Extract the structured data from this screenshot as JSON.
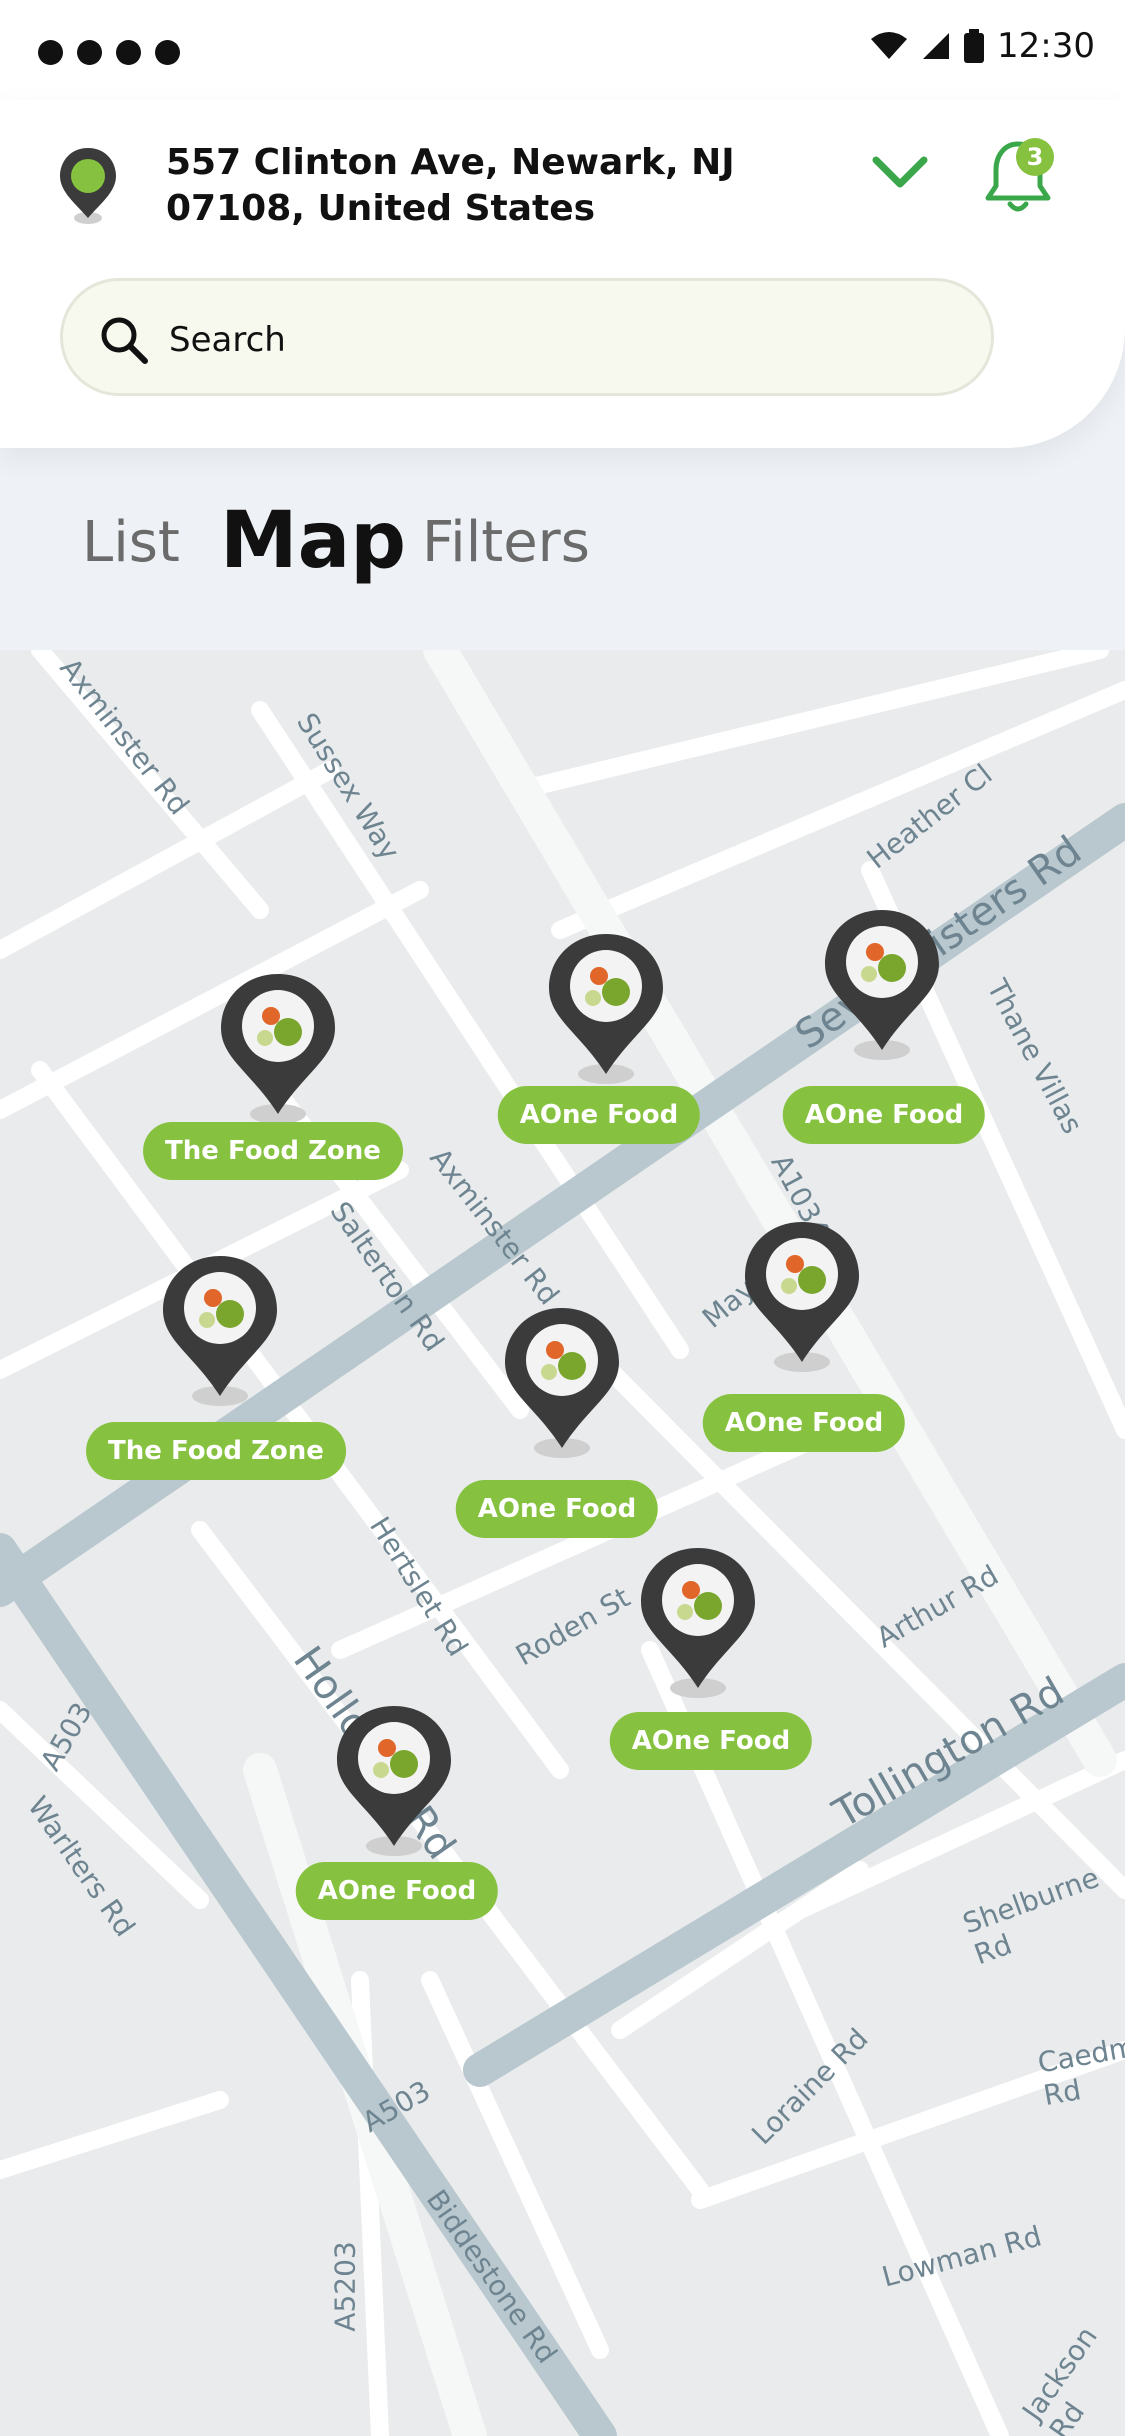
{
  "status_bar": {
    "time": "12:30"
  },
  "header": {
    "address": "557 Clinton Ave, Newark, NJ 07108, United States",
    "notification_count": "3"
  },
  "search": {
    "placeholder": "Search"
  },
  "tabs": {
    "list": "List",
    "map": "Map",
    "filters": "Filters"
  },
  "colors": {
    "accent": "#86c240",
    "pin": "#3b3b3b"
  },
  "map": {
    "streets": [
      "Axminster Rd",
      "Sussex Way",
      "Heather Cl",
      "Seven Sisters Rd",
      "Thane Villas",
      "A1034",
      "Salterton Rd",
      "Axminster Rd",
      "Mayton St",
      "Hertslet Rd",
      "Roden St",
      "Arthur Rd",
      "Tollington Rd",
      "Holloway Rd",
      "A503",
      "Warlters Rd",
      "Shelburne Rd",
      "Caedmon Rd",
      "Loraine Rd",
      "Lowman Rd",
      "A5203",
      "Biddestone Rd",
      "Jackson Rd",
      "A503"
    ],
    "pins": [
      {
        "label": "The Food Zone"
      },
      {
        "label": "AOne Food"
      },
      {
        "label": "AOne Food"
      },
      {
        "label": "The Food Zone"
      },
      {
        "label": "AOne Food"
      },
      {
        "label": "AOne Food"
      },
      {
        "label": "AOne Food"
      },
      {
        "label": "AOne Food"
      }
    ]
  }
}
